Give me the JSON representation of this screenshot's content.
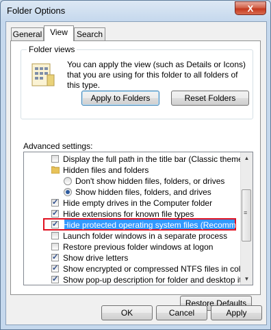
{
  "window": {
    "title": "Folder Options",
    "close_label": "X"
  },
  "tabs": [
    {
      "label": "General",
      "active": false
    },
    {
      "label": "View",
      "active": true
    },
    {
      "label": "Search",
      "active": false
    }
  ],
  "folder_views": {
    "legend": "Folder views",
    "description": "You can apply the view (such as Details or Icons) that you are using for this folder to all folders of this type.",
    "apply_label": "Apply to Folders",
    "reset_label": "Reset Folders"
  },
  "advanced": {
    "label": "Advanced settings:",
    "items": [
      {
        "type": "checkbox",
        "label": "Display the full path in the title bar (Classic theme only)",
        "checked": false
      },
      {
        "type": "folder",
        "label": "Hidden files and folders"
      },
      {
        "type": "radio",
        "label": "Don't show hidden files, folders, or drives",
        "checked": false
      },
      {
        "type": "radio",
        "label": "Show hidden files, folders, and drives",
        "checked": true
      },
      {
        "type": "checkbox",
        "label": "Hide empty drives in the Computer folder",
        "checked": true
      },
      {
        "type": "checkbox",
        "label": "Hide extensions for known file types",
        "checked": true
      },
      {
        "type": "checkbox",
        "label": "Hide protected operating system files (Recommended)",
        "checked": true,
        "selected": true
      },
      {
        "type": "checkbox",
        "label": "Launch folder windows in a separate process",
        "checked": false
      },
      {
        "type": "checkbox",
        "label": "Restore previous folder windows at logon",
        "checked": false
      },
      {
        "type": "checkbox",
        "label": "Show drive letters",
        "checked": true
      },
      {
        "type": "checkbox",
        "label": "Show encrypted or compressed NTFS files in color",
        "checked": true
      },
      {
        "type": "checkbox",
        "label": "Show pop-up description for folder and desktop items",
        "checked": true
      }
    ],
    "restore_label": "Restore Defaults"
  },
  "footer": {
    "ok_label": "OK",
    "cancel_label": "Cancel",
    "apply_label": "Apply"
  },
  "colors": {
    "highlight_border": "#e01020",
    "selection": "#3399ff",
    "close": "#c5391f"
  }
}
